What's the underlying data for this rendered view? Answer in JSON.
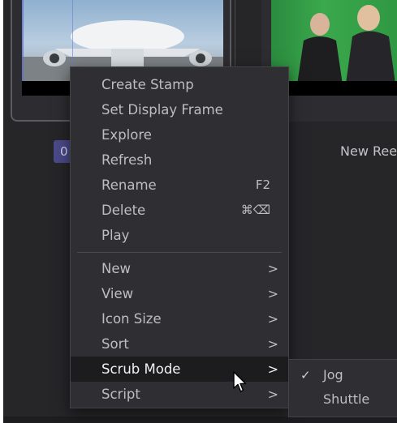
{
  "media_pool": {
    "clip_badge": "0",
    "clip_name": "New Ree"
  },
  "context_menu": {
    "items": [
      {
        "label": "Create Stamp"
      },
      {
        "label": "Set Display Frame"
      },
      {
        "label": "Explore"
      },
      {
        "label": "Refresh"
      },
      {
        "label": "Rename",
        "shortcut": "F2"
      },
      {
        "label": "Delete",
        "shortcut": "⌘⌫"
      },
      {
        "label": "Play"
      },
      {
        "label": "New",
        "submenu": true,
        "chevron": ">"
      },
      {
        "label": "View",
        "submenu": true,
        "chevron": ">"
      },
      {
        "label": "Icon Size",
        "submenu": true,
        "chevron": ">"
      },
      {
        "label": "Sort",
        "submenu": true,
        "chevron": ">"
      },
      {
        "label": "Scrub Mode",
        "submenu": true,
        "chevron": ">",
        "highlighted": true
      },
      {
        "label": "Script",
        "submenu": true,
        "chevron": ">"
      }
    ]
  },
  "scrub_submenu": {
    "items": [
      {
        "label": "Jog",
        "checked": true,
        "check": "✓"
      },
      {
        "label": "Shuttle",
        "checked": false
      }
    ]
  },
  "icons": {
    "cursor": "arrow-pointer-icon",
    "check": "checkmark-icon",
    "chevron": "chevron-right-icon"
  }
}
